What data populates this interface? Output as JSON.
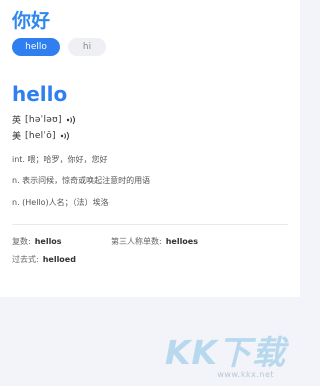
{
  "search": {
    "query": "你好"
  },
  "tabs": [
    {
      "label": "hello",
      "active": true
    },
    {
      "label": "hi",
      "active": false
    }
  ],
  "entry": {
    "word": "hello",
    "pronunciations": [
      {
        "region": "英",
        "ipa": "[həˈləʊ]"
      },
      {
        "region": "美",
        "ipa": "[helˈō]"
      }
    ],
    "definitions": [
      "int. 喂；哈罗，你好，您好",
      "n. 表示问候，惊奇或唤起注意时的用语",
      "n. (Hello)人名；（法）埃洛"
    ],
    "forms": {
      "plural_label": "复数:",
      "plural_value": "hellos",
      "third_label": "第三人称单数:",
      "third_value": "helloes",
      "past_label": "过去式:",
      "past_value": "helloed"
    }
  },
  "watermark": {
    "brand": "KK下载",
    "url": "www.kkx.net"
  },
  "colors": {
    "accent": "#2f7ff0",
    "background": "#f2f4f9"
  }
}
